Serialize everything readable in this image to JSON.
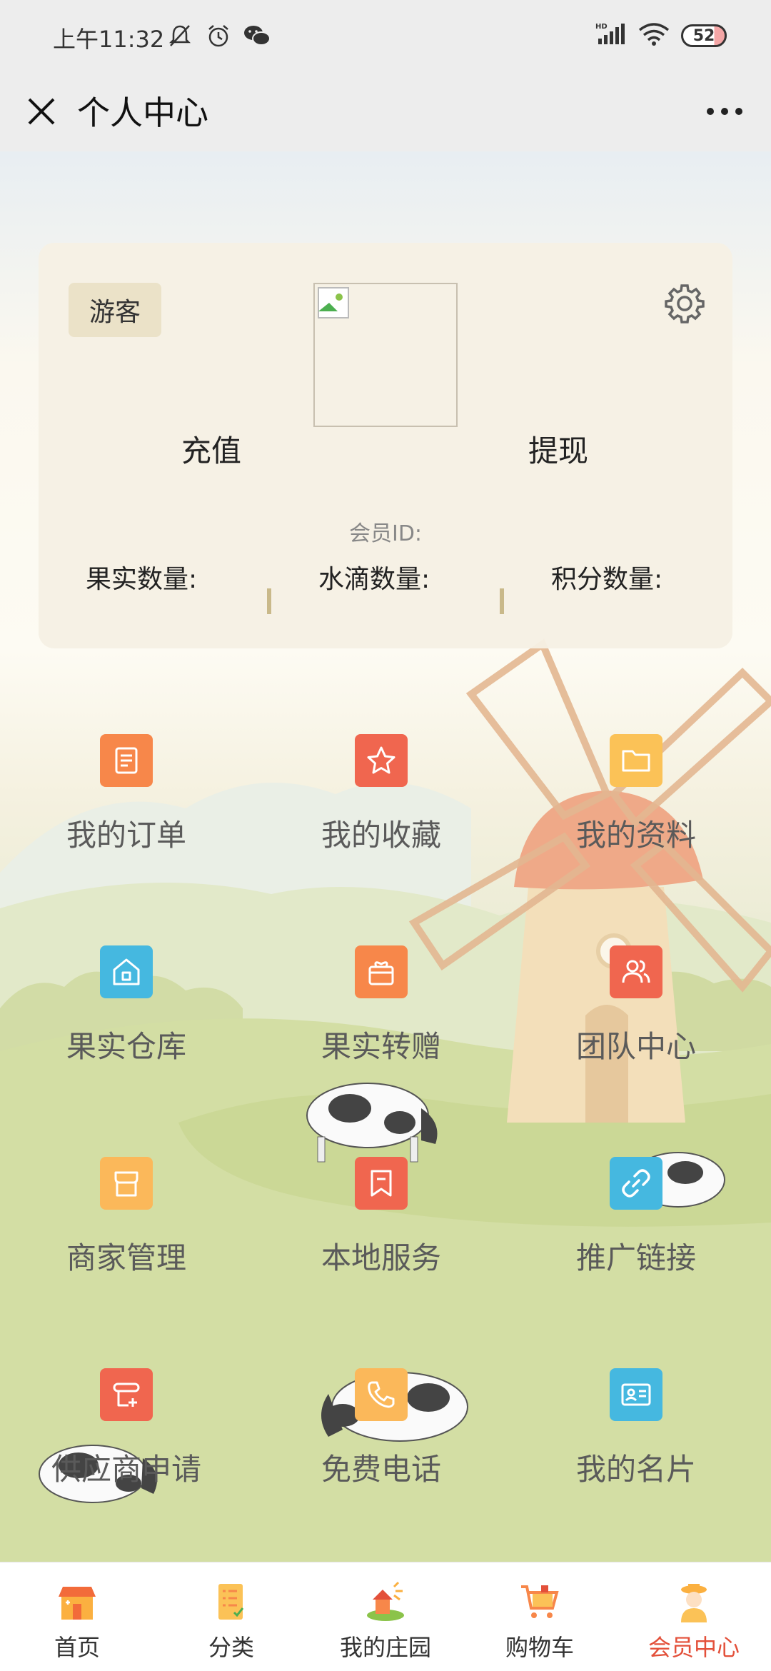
{
  "status_bar": {
    "time": "上午11:32",
    "battery": "52",
    "icons": [
      "mute-icon",
      "alarm-icon",
      "wechat-icon",
      "hd-signal-icon",
      "wifi-icon",
      "battery-icon"
    ]
  },
  "title_bar": {
    "title": "个人中心",
    "close_icon": "close-icon",
    "more_icon": "more-icon"
  },
  "profile": {
    "guest_label": "游客",
    "recharge_label": "充值",
    "withdraw_label": "提现",
    "member_id_label": "会员ID:",
    "fruit_count_label": "果实数量:",
    "water_count_label": "水滴数量:",
    "points_count_label": "积分数量:"
  },
  "menu": {
    "items": [
      {
        "label": "我的订单",
        "icon": "order-icon",
        "color": "#f7874a"
      },
      {
        "label": "我的收藏",
        "icon": "star-icon",
        "color": "#f0664f"
      },
      {
        "label": "我的资料",
        "icon": "folder-icon",
        "color": "#fbc257"
      },
      {
        "label": "果实仓库",
        "icon": "home-icon",
        "color": "#45b8e0"
      },
      {
        "label": "果实转赠",
        "icon": "gift-icon",
        "color": "#f7874a"
      },
      {
        "label": "团队中心",
        "icon": "team-icon",
        "color": "#f0664f"
      },
      {
        "label": "商家管理",
        "icon": "store-icon",
        "color": "#fbb85a"
      },
      {
        "label": "本地服务",
        "icon": "bookmark-icon",
        "color": "#f0664f"
      },
      {
        "label": "推广链接",
        "icon": "link-icon",
        "color": "#45b8e0"
      },
      {
        "label": "供应商申请",
        "icon": "apply-icon",
        "color": "#f0664f"
      },
      {
        "label": "免费电话",
        "icon": "phone-icon",
        "color": "#fbb85a"
      },
      {
        "label": "我的名片",
        "icon": "card-icon",
        "color": "#45b8e0"
      }
    ]
  },
  "tab_bar": {
    "tabs": [
      {
        "label": "首页",
        "icon": "home-tab-icon"
      },
      {
        "label": "分类",
        "icon": "category-tab-icon"
      },
      {
        "label": "我的庄园",
        "icon": "manor-tab-icon"
      },
      {
        "label": "购物车",
        "icon": "cart-tab-icon"
      },
      {
        "label": "会员中心",
        "icon": "member-tab-icon"
      }
    ],
    "active_color": "#e3503a"
  }
}
